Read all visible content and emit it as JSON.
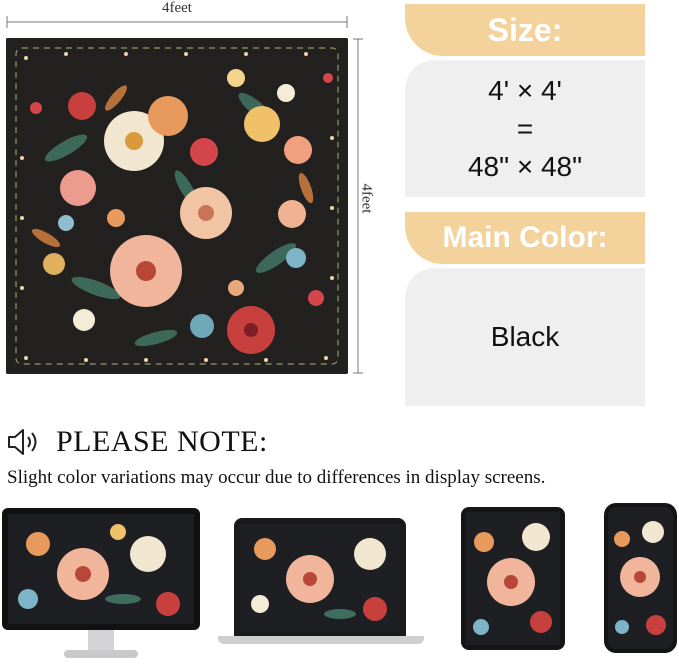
{
  "dimensions": {
    "top_label": "4feet",
    "side_label": "4feet"
  },
  "size_card": {
    "heading": "Size:",
    "line1": "4' × 4'",
    "line2": "=",
    "line3": "48\" × 48\""
  },
  "color_card": {
    "heading": "Main Color:",
    "value": "Black"
  },
  "note": {
    "icon": "speaker-icon",
    "title": "PLEASE NOTE:",
    "text": "Slight color variations may occur due to differences in display screens."
  },
  "devices": [
    "monitor",
    "laptop",
    "tablet",
    "phone"
  ],
  "colors": {
    "rug_background": "#232020",
    "accent": "#f3d29c",
    "card_background": "#efeff0"
  }
}
